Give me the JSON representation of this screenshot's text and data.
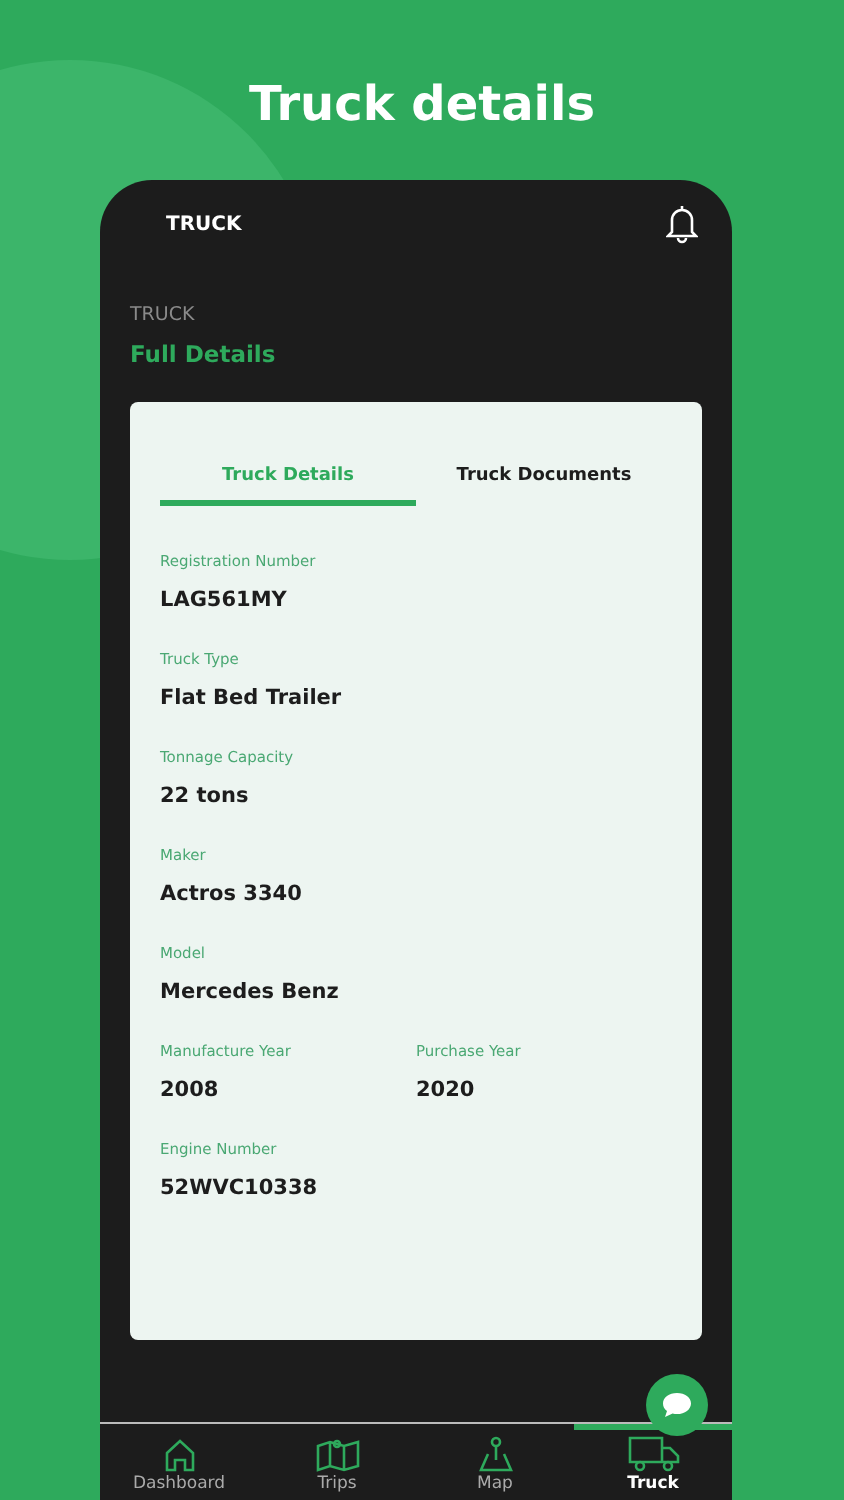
{
  "headline": "Truck details",
  "app_bar": {
    "title": "TRUCK"
  },
  "section": {
    "overline": "TRUCK",
    "title": "Full Details"
  },
  "tabs": [
    {
      "label": "Truck Details",
      "selected": true
    },
    {
      "label": "Truck Documents",
      "selected": false
    }
  ],
  "detail_rows": [
    {
      "fields": [
        {
          "label": "Registration Number",
          "value": "LAG561MY"
        }
      ]
    },
    {
      "fields": [
        {
          "label": "Truck Type",
          "value": "Flat Bed Trailer"
        }
      ]
    },
    {
      "fields": [
        {
          "label": "Tonnage Capacity",
          "value": "22 tons"
        }
      ]
    },
    {
      "fields": [
        {
          "label": "Maker",
          "value": "Actros 3340"
        }
      ]
    },
    {
      "fields": [
        {
          "label": "Model",
          "value": "Mercedes Benz"
        }
      ]
    },
    {
      "fields": [
        {
          "label": "Manufacture Year",
          "value": "2008"
        },
        {
          "label": "Purchase Year",
          "value": "2020"
        }
      ]
    },
    {
      "fields": [
        {
          "label": "Engine Number",
          "value": "52WVC10338"
        }
      ]
    }
  ],
  "bottom_nav": [
    {
      "label": "Dashboard",
      "selected": false
    },
    {
      "label": "Trips",
      "selected": false
    },
    {
      "label": "Map",
      "selected": false
    },
    {
      "label": "Truck",
      "selected": true
    }
  ]
}
